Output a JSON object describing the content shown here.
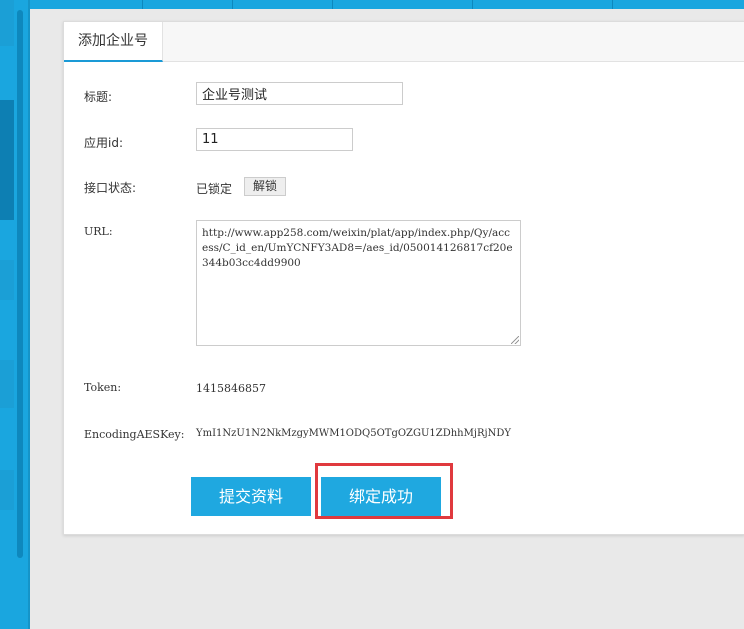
{
  "colors": {
    "accent": "#1fa8e0",
    "sidebar": "#1aa6df",
    "highlight_border": "#e0393e"
  },
  "tab": {
    "label": "添加企业号"
  },
  "form": {
    "title_label": "标题:",
    "title_value": "企业号测试",
    "appid_label": "应用id:",
    "appid_value": "11",
    "status_label": "接口状态:",
    "status_value": "已锁定",
    "unlock_label": "解锁",
    "url_label": "URL:",
    "url_value": "http://www.app258.com/weixin/plat/app/index.php/Qy/access/C_id_en/UmYCNFY3AD8=/aes_id/050014126817cf20e344b03cc4dd9900",
    "token_label": "Token:",
    "token_value": "1415846857",
    "aeskey_label": "EncodingAESKey:",
    "aeskey_value": "YmI1NzU1N2NkMzgyMWM1ODQ5OTgOZGU1ZDhhMjRjNDY"
  },
  "buttons": {
    "submit_label": "提交资料",
    "bind_label": "绑定成功"
  }
}
